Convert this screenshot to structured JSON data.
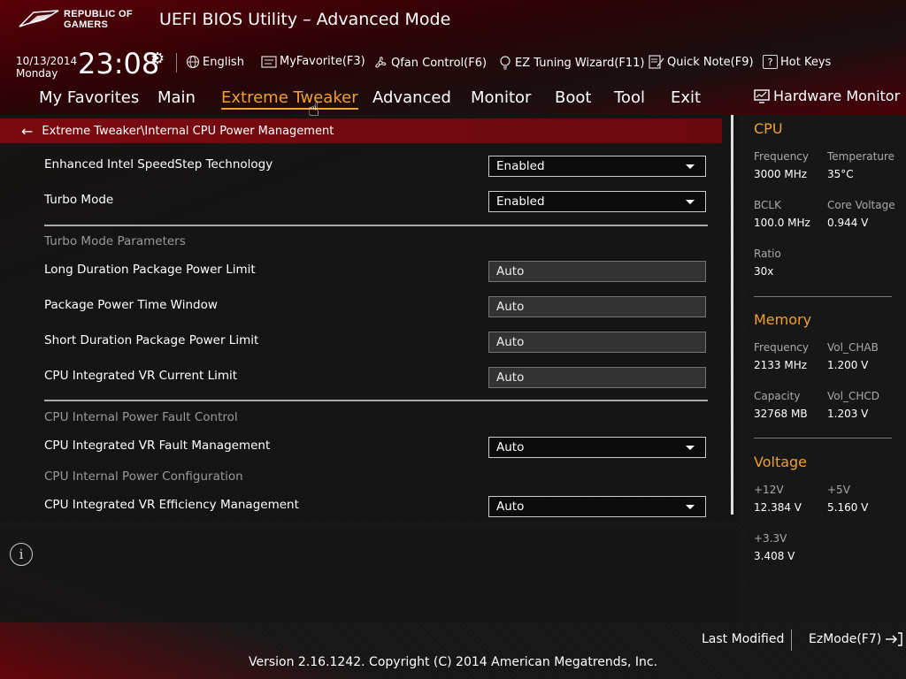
{
  "header": {
    "logo_line1": "REPUBLIC OF",
    "logo_line2": "GAMERS",
    "title": "UEFI BIOS Utility – Advanced Mode"
  },
  "clock": {
    "date": "10/13/2014",
    "day": "Monday",
    "time": "23:08"
  },
  "toolbar": {
    "language": "English",
    "favorite": "MyFavorite(F3)",
    "qfan": "Qfan Control(F6)",
    "ez_tuning": "EZ Tuning Wizard(F11)",
    "quick_note": "Quick Note(F9)",
    "hot_keys": "Hot Keys",
    "hot_keys_glyph": "?"
  },
  "menu": {
    "favorites": "My Favorites",
    "main": "Main",
    "extreme_tweaker": "Extreme Tweaker",
    "advanced": "Advanced",
    "monitor": "Monitor",
    "boot": "Boot",
    "tool": "Tool",
    "exit": "Exit",
    "active": "Extreme Tweaker"
  },
  "breadcrumb": "Extreme Tweaker\\Internal CPU Power Management",
  "settings": {
    "speedstep": {
      "label": "Enhanced Intel SpeedStep Technology",
      "value": "Enabled"
    },
    "turbo": {
      "label": "Turbo Mode",
      "value": "Enabled"
    },
    "turbo_params_section": "Turbo Mode Parameters",
    "long_duration": {
      "label": "Long Duration Package Power Limit",
      "value": "Auto"
    },
    "time_window": {
      "label": "Package Power Time Window",
      "value": "Auto"
    },
    "short_duration": {
      "label": "Short Duration Package Power Limit",
      "value": "Auto"
    },
    "vr_current": {
      "label": "CPU Integrated VR Current Limit",
      "value": "Auto"
    },
    "fault_section": "CPU Internal Power Fault Control",
    "vr_fault": {
      "label": "CPU Integrated VR Fault Management",
      "value": "Auto"
    },
    "config_section": "CPU Internal Power Configuration",
    "vr_efficiency": {
      "label": "CPU Integrated VR Efficiency Management",
      "value": "Auto"
    }
  },
  "info_glyph": "i",
  "hardware_monitor": {
    "title": "Hardware Monitor",
    "cpu": {
      "title": "CPU",
      "frequency_label": "Frequency",
      "frequency": "3000 MHz",
      "temperature_label": "Temperature",
      "temperature": "35°C",
      "bclk_label": "BCLK",
      "bclk": "100.0 MHz",
      "core_voltage_label": "Core Voltage",
      "core_voltage": "0.944 V",
      "ratio_label": "Ratio",
      "ratio": "30x"
    },
    "memory": {
      "title": "Memory",
      "frequency_label": "Frequency",
      "frequency": "2133 MHz",
      "vol_chab_label": "Vol_CHAB",
      "vol_chab": "1.200 V",
      "capacity_label": "Capacity",
      "capacity": "32768 MB",
      "vol_chcd_label": "Vol_CHCD",
      "vol_chcd": "1.203 V"
    },
    "voltage": {
      "title": "Voltage",
      "v12_label": "+12V",
      "v12": "12.384 V",
      "v5_label": "+5V",
      "v5": "5.160 V",
      "v33_label": "+3.3V",
      "v33": "3.408 V"
    }
  },
  "footer": {
    "last_modified": "Last Modified",
    "ezmode": "EzMode(F7)",
    "copyright": "Version 2.16.1242. Copyright (C) 2014 American Megatrends, Inc."
  },
  "colors": {
    "accent": "#f0a030",
    "breadcrumb_bg": "#7a0a10"
  }
}
